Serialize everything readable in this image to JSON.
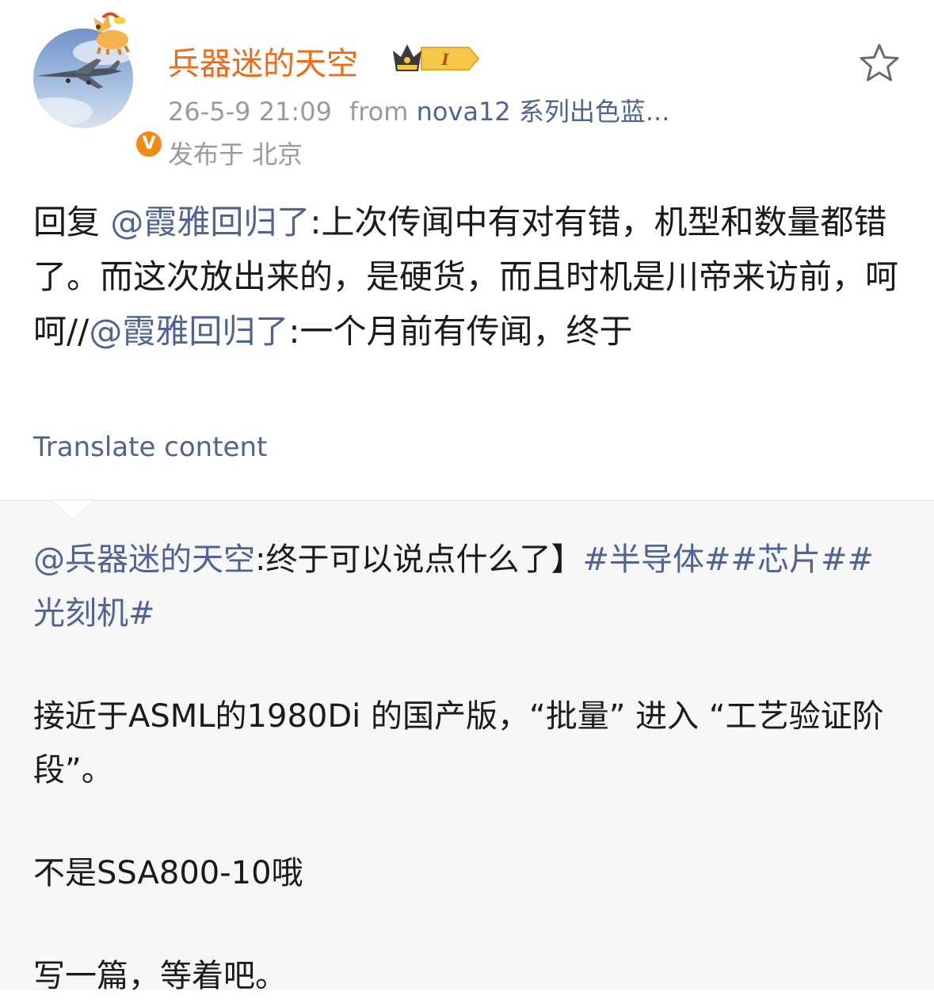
{
  "post": {
    "author": {
      "name": "兵器迷的天空",
      "verified_badge": "V",
      "level_badge": "I",
      "avatar_icon": "fighter-jet-avatar",
      "colors": {
        "name": "#ef6b16",
        "badge": "#f08c13"
      }
    },
    "timestamp": "26-5-9 21:09",
    "from_label": "from",
    "device": "nova12 系列出色蓝...",
    "location": "发布于 北京",
    "body": {
      "reply_prefix": "回复",
      "mention_1": "@霞雅回归了",
      "text_1": ":上次传闻中有对有错，机型和数量都错了。而这次放出来的，是硬货，而且时机是川帝来访前，呵呵//",
      "mention_2": "@霞雅回归了",
      "text_2": ":一个月前有传闻，终于"
    },
    "translate_label": "Translate content"
  },
  "repost": {
    "mention": "@兵器迷的天空",
    "text_1": ":终于可以说点什么了】",
    "hashtags": "#半导体##芯片##光刻机#",
    "paragraph_2": "接近于ASML的1980Di 的国产版，“批量” 进入 “工艺验证阶段”。",
    "paragraph_3": "不是SSA800-10哦",
    "paragraph_4": "写一篇，等着吧。"
  },
  "colors": {
    "link": "#4f6394",
    "meta": "#9a9a9a",
    "repost_bg": "#f7f7f7"
  },
  "icons": [
    "star-icon",
    "crown-level-icon",
    "horse-icon",
    "verified-icon"
  ]
}
